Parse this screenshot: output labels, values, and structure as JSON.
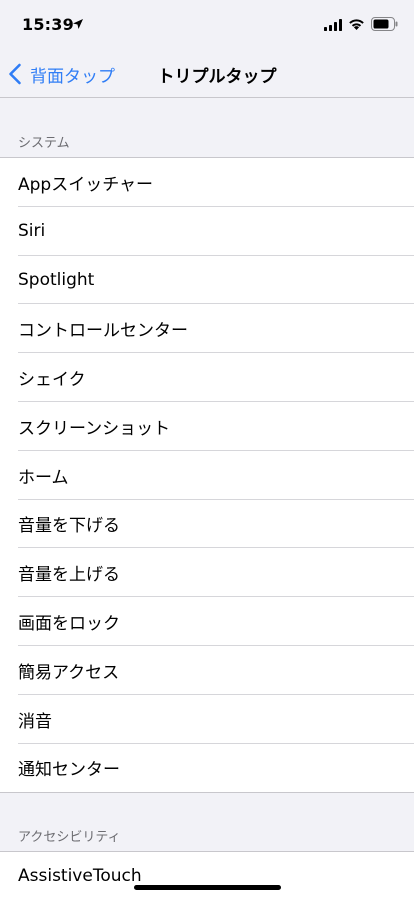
{
  "status_bar": {
    "time": "15:39",
    "icons": [
      "location-arrow-icon",
      "cellular-signal-icon",
      "wifi-icon",
      "battery-icon"
    ]
  },
  "nav": {
    "back_label": "背面タップ",
    "title": "トリプルタップ",
    "accent_color": "#2f7df6"
  },
  "sections": {
    "system": {
      "header": "システム",
      "items": [
        {
          "label": "Appスイッチャー"
        },
        {
          "label": "Siri"
        },
        {
          "label": "Spotlight"
        },
        {
          "label": "コントロールセンター"
        },
        {
          "label": "シェイク"
        },
        {
          "label": "スクリーンショット"
        },
        {
          "label": "ホーム"
        },
        {
          "label": "音量を下げる"
        },
        {
          "label": "音量を上げる"
        },
        {
          "label": "画面をロック"
        },
        {
          "label": "簡易アクセス"
        },
        {
          "label": "消音"
        },
        {
          "label": "通知センター"
        }
      ]
    },
    "accessibility": {
      "header": "アクセシビリティ",
      "items": [
        {
          "label": "AssistiveTouch"
        }
      ]
    }
  }
}
